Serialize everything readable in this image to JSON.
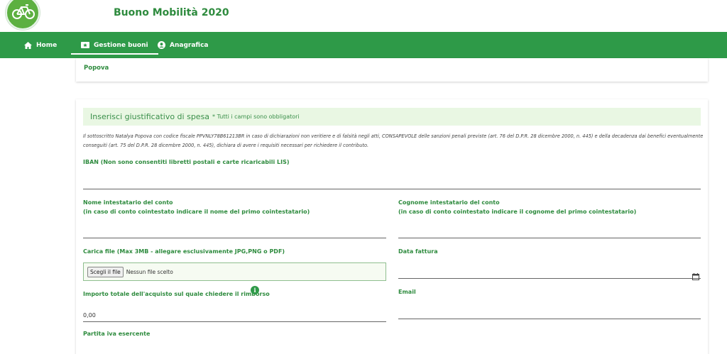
{
  "app": {
    "title": "Buono Mobilità 2020",
    "logo_icon": "bicycle-icon"
  },
  "colors": {
    "brand_green": "#2e9a48",
    "label_green": "#2e8b3e",
    "header_bg": "#e9f7e3"
  },
  "nav": {
    "items": [
      {
        "label": "Home",
        "icon": "home-icon"
      },
      {
        "label": "Gestione buoni",
        "icon": "ticket-icon",
        "active": true
      },
      {
        "label": "Anagrafica",
        "icon": "user-circle-icon"
      }
    ]
  },
  "top_card": {
    "surname_value": "Popova"
  },
  "form": {
    "section_title": "Inserisci giustificativo di spesa",
    "section_note": "* Tutti i campi sono obbligatori",
    "declaration": "Il sottoscritto Natalya Popova con codice fiscale PPVNLY78B61213BR in caso di dichiarazioni non veritiere e di falsità negli atti, CONSAPEVOLE delle sanzioni penali previste (art. 76 del D.P.R. 28 dicembre 2000, n. 445) e della decadenza dai benefici eventualmente conseguiti (art. 75 del D.P.R. 28 dicembre 2000, n. 445), dichiara di avere i requisiti necessari per richiedere il contributo.",
    "iban_label": "IBAN (Non sono consentiti libretti postali e carte ricaricabili LIS)",
    "iban_value": "",
    "nome_label": "Nome intestatario del conto",
    "nome_sublabel": "(in caso di conto cointestato indicare il nome del primo cointestatario)",
    "nome_value": "",
    "cognome_label": "Cognome intestatario del conto",
    "cognome_sublabel": "(in caso di conto cointestato indicare il cognome del primo cointestatario)",
    "cognome_value": "",
    "file_label": "Carica file (Max 3MB - allegare esclusivamente JPG,PNG o PDF)",
    "file_button": "Scegli il file",
    "file_status": "Nessun file scelto",
    "data_fattura_label": "Data fattura",
    "data_fattura_value": "",
    "importo_label": "Importo totale dell'acquisto sul quale chiedere il rimborso",
    "importo_value": "0,00",
    "email_label": "Email",
    "email_value": "",
    "partita_iva_label": "Partita iva esercente"
  }
}
